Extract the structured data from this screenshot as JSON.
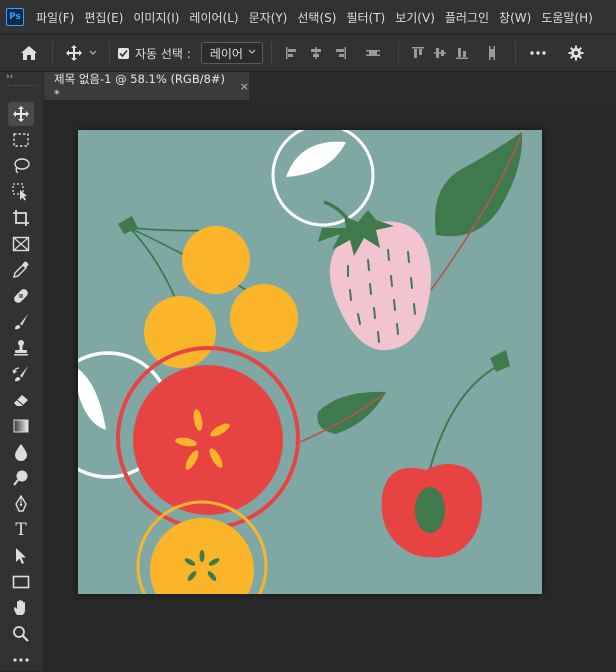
{
  "app": {
    "logo_text": "Ps"
  },
  "menu": [
    {
      "label": "파일(F)"
    },
    {
      "label": "편집(E)"
    },
    {
      "label": "이미지(I)"
    },
    {
      "label": "레이어(L)"
    },
    {
      "label": "문자(Y)"
    },
    {
      "label": "선택(S)"
    },
    {
      "label": "필터(T)"
    },
    {
      "label": "보기(V)"
    },
    {
      "label": "플러그인"
    },
    {
      "label": "창(W)"
    },
    {
      "label": "도움말(H)"
    }
  ],
  "options": {
    "auto_select_label": "자동 선택 :",
    "auto_select_checked": true,
    "auto_select_target": "레이어"
  },
  "document_tab": {
    "title": "제목 없음-1 @ 58.1% (RGB/8#) *",
    "close": "×"
  },
  "toolbar_collapse": "››",
  "tools": [
    {
      "name": "move-tool",
      "active": true
    },
    {
      "name": "marquee-tool"
    },
    {
      "name": "lasso-tool"
    },
    {
      "name": "object-selection-tool"
    },
    {
      "name": "crop-tool"
    },
    {
      "name": "frame-tool"
    },
    {
      "name": "eyedropper-tool"
    },
    {
      "name": "healing-brush-tool"
    },
    {
      "name": "brush-tool"
    },
    {
      "name": "clone-stamp-tool"
    },
    {
      "name": "history-brush-tool"
    },
    {
      "name": "eraser-tool"
    },
    {
      "name": "gradient-tool"
    },
    {
      "name": "blur-tool"
    },
    {
      "name": "dodge-tool"
    },
    {
      "name": "pen-tool"
    },
    {
      "name": "type-tool",
      "glyph": "T"
    },
    {
      "name": "path-selection-tool"
    },
    {
      "name": "rectangle-tool"
    },
    {
      "name": "hand-tool"
    },
    {
      "name": "zoom-tool"
    },
    {
      "name": "edit-toolbar"
    }
  ],
  "colors": {
    "canvas_bg": "#7fa8a5",
    "red": "#e84343",
    "yellow": "#fbb52b",
    "green": "#3e7a4c",
    "pink": "#f2c4cf",
    "white": "#ffffff",
    "ui_dark": "#282828",
    "ui_panel": "#323232"
  }
}
